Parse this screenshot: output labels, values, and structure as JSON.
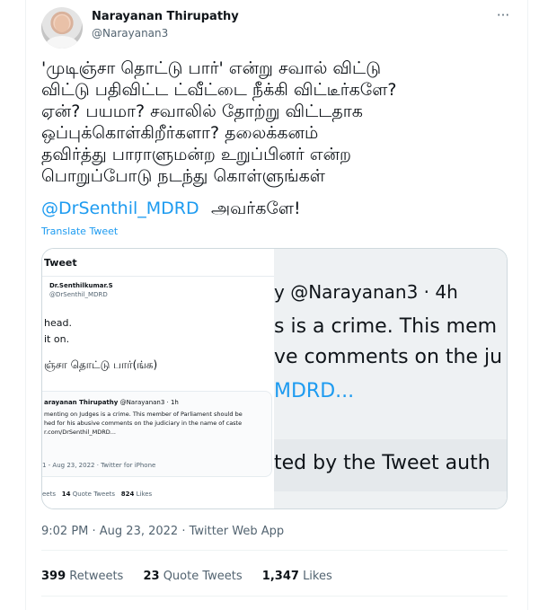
{
  "author": {
    "name": "Narayanan Thirupathy",
    "handle": "@Narayanan3"
  },
  "more_icon": "more-horizontal-icon",
  "tweet": {
    "text": "'முடிஞ்சா தொட்டு பார்' என்று சவால் விட்டு\nவிட்டு பதிவிட்ட ட்வீட்டை நீக்கி விட்டீர்களே?\nஏன்? பயமா? சவாலில் தோற்று விட்டதாக\nஒப்புக்கொள்கிறீர்களா? தலைக்கனம்\nதவிர்த்து பாராளுமன்ற உறுப்பினர் என்ற\nபொறுப்போடு நடந்து கொள்ளுங்கள்",
    "mention": "@DrSenthil_MDRD",
    "mention_tail": "அவர்களே!",
    "translate": "Translate Tweet"
  },
  "embedded_left": {
    "title": "Tweet",
    "name": "Dr.Senthilkumar.S",
    "handle": "@DrSenthil_MDRD",
    "body_line1": "head.",
    "body_line2": "it on.",
    "tamil": "ஞ்சா தொட்டு பார்(ங்க)",
    "quote": {
      "author": "arayanan Thirupathy",
      "meta": "@Narayanan3 · 1h",
      "line1": "menting on Judges is a crime. This member of Parliament should be",
      "line2": "hed for his abusive comments on the judiciary in the name of caste",
      "line3": "r.com/DrSenthil_MDRD...",
      "time": "1 - Aug 23, 2022 · Twitter for iPhone"
    },
    "stats": {
      "retweets_label": "eets",
      "quotes_num": "14",
      "quotes_label": "Quote Tweets",
      "likes_num": "824",
      "likes_label": "Likes"
    }
  },
  "embedded_right": {
    "header": "y @Narayanan3 · 4h",
    "line1": "s is a crime. This mem",
    "line2": "ve comments on the ju",
    "line3": "MDRD...",
    "line4": "ted by the Tweet auth"
  },
  "timestamp": "9:02 PM · Aug 23, 2022 · Twitter Web App",
  "stats": {
    "retweets_num": "399",
    "retweets_label": "Retweets",
    "quotes_num": "23",
    "quotes_label": "Quote Tweets",
    "likes_num": "1,347",
    "likes_label": "Likes"
  }
}
